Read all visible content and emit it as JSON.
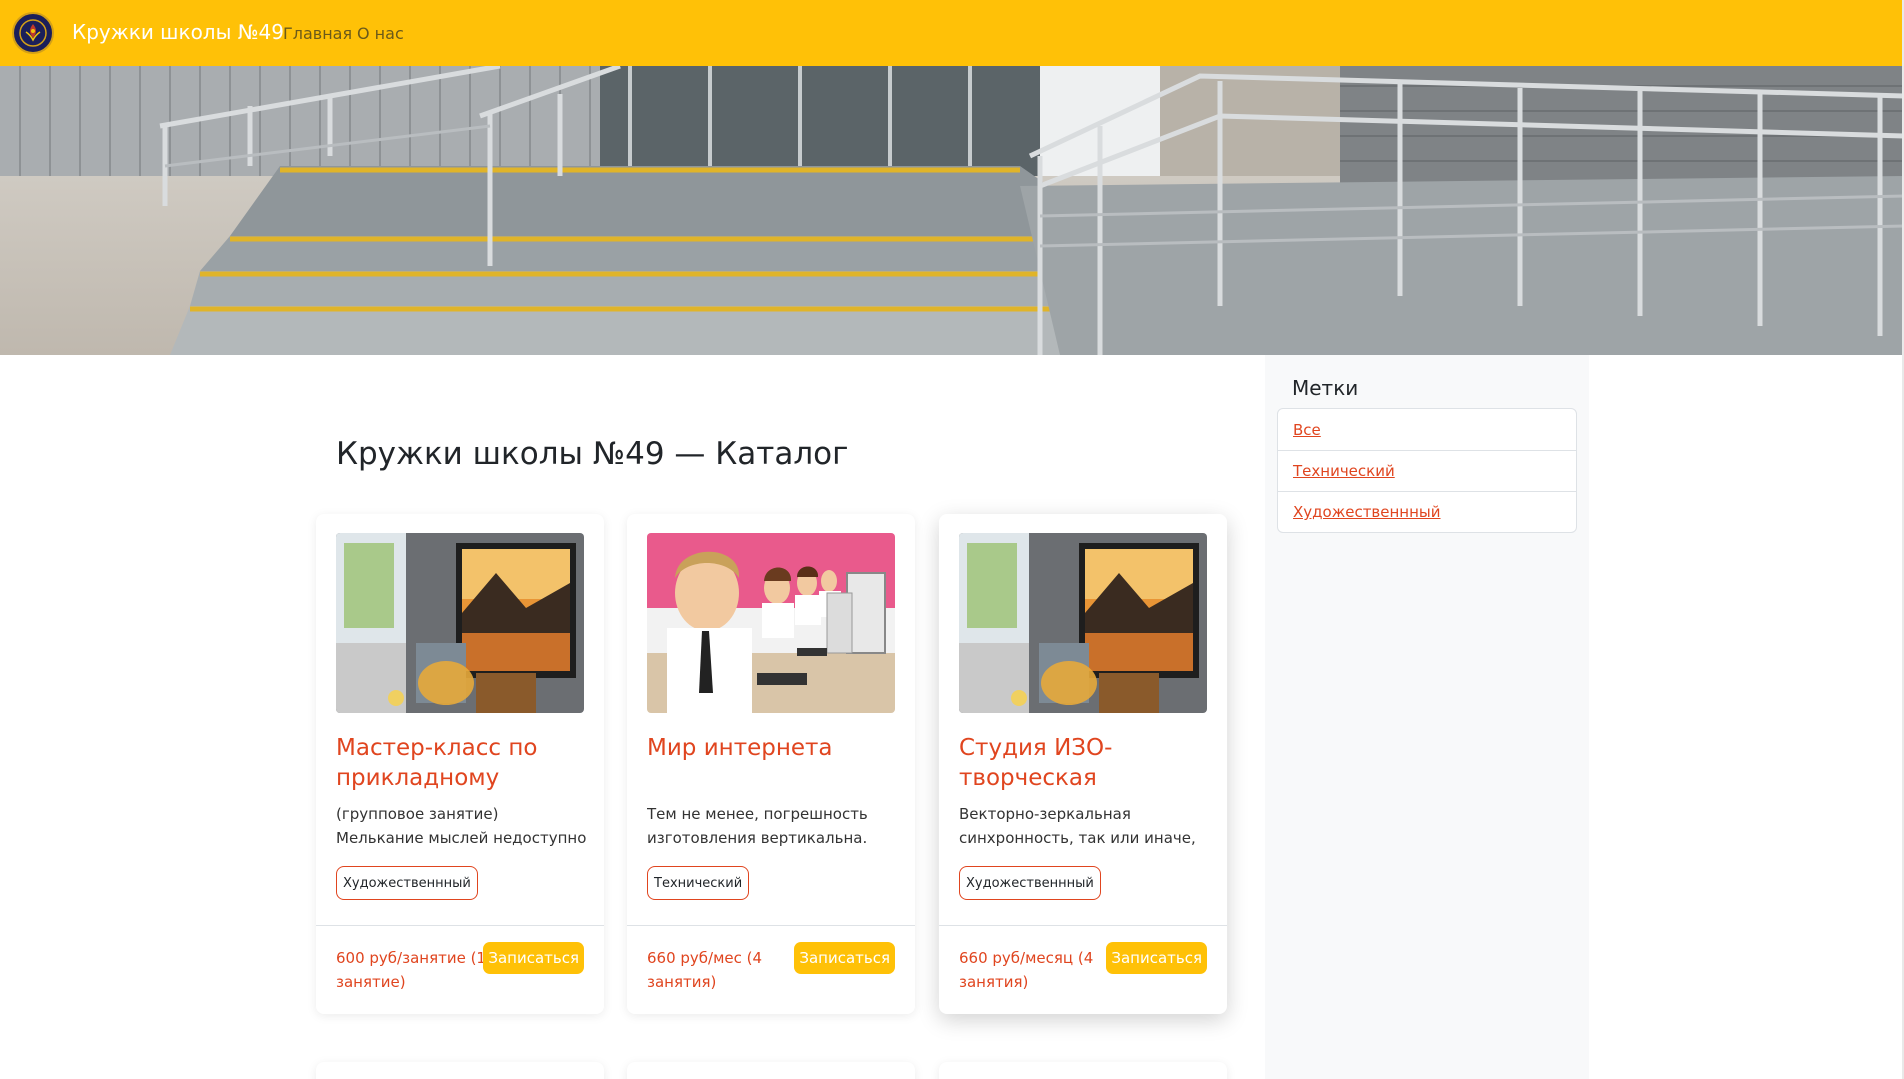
{
  "navbar": {
    "brand": "Кружки школы №49",
    "links": [
      "Главная",
      "О нас"
    ],
    "logo_icon": "school-emblem-icon",
    "bg_color": "#ffc107"
  },
  "main": {
    "title": "Кружки школы №49 — Каталог"
  },
  "cards": [
    {
      "title": "Мастер-класс по прикладному",
      "text": "(групповое занятие) Мелькание мыслей недоступно приводит",
      "tag": "Художественнный",
      "price": "600 руб/занятие (1 занятие)",
      "button": "Записаться",
      "image": "art-studio-easel-photo"
    },
    {
      "title": "Мир интернета",
      "text": "Тем не менее, погрешность изготовления вертикальна.",
      "tag": "Технический",
      "price": "660 руб/мес (4 занятия)",
      "button": "Записаться",
      "image": "students-computers-photo"
    },
    {
      "title": "Студия ИЗО-творческая",
      "text": "Векторно-зеркальная синхронность, так или иначе,",
      "tag": "Художественнный",
      "price": "660 руб/месяц (4 занятия)",
      "button": "Записаться",
      "image": "art-studio-easel-photo"
    }
  ],
  "sidebar": {
    "title": "Метки",
    "tags": [
      "Все",
      "Технический",
      "Художественнный"
    ]
  },
  "colors": {
    "accent": "#ffc107",
    "link": "#e0451f",
    "sidebar_bg": "#f8f9fa"
  }
}
